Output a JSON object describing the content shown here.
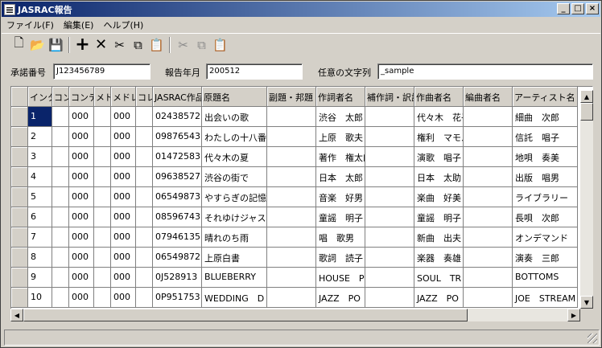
{
  "window": {
    "title": "JASRAC報告",
    "minimize": "_",
    "maximize": "□",
    "close": "×"
  },
  "menu": [
    "ファイル(F)",
    "編集(E)",
    "ヘルプ(H)"
  ],
  "toolbar": {
    "new": "🗋",
    "open": "📂",
    "save": "💾",
    "add": "+",
    "delete": "✕",
    "cut": "✂",
    "copy": "⧉",
    "paste": "📋",
    "cut2": "✂",
    "copy2": "⧉",
    "paste2": "📋"
  },
  "fields": {
    "license_label": "承諾番号",
    "license_value": "J123456789",
    "report_label": "報告年月",
    "report_value": "200512",
    "free_label": "任意の文字列",
    "free_value": "_sample"
  },
  "grid": {
    "columns": [
      "インター",
      "コンテ",
      "コンテン",
      "メド",
      "メドレー",
      "コレク",
      "JASRAC作品",
      "原題名",
      "副題・邦題",
      "作詞者名",
      "補作詞・訳詞",
      "作曲者名",
      "編曲者名",
      "アーティスト名"
    ],
    "rows": [
      [
        "1",
        "",
        "000",
        "",
        "000",
        "",
        "02438572",
        "出会いの歌",
        "",
        "渋谷　太郎",
        "",
        "代々木　花子",
        "",
        "細曲　次郎"
      ],
      [
        "2",
        "",
        "000",
        "",
        "000",
        "",
        "09876543",
        "わたしの十八番",
        "",
        "上原　歌夫",
        "",
        "権利　マモル",
        "",
        "信託　唱子"
      ],
      [
        "3",
        "",
        "000",
        "",
        "000",
        "",
        "01472583",
        "代々木の夏",
        "",
        "著作　権太郎",
        "",
        "演歌　唱子",
        "",
        "地唄　奏美"
      ],
      [
        "4",
        "",
        "000",
        "",
        "000",
        "",
        "09638527",
        "渋谷の街で",
        "",
        "日本　太郎",
        "",
        "日本　太助",
        "",
        "出版　唱男"
      ],
      [
        "5",
        "",
        "000",
        "",
        "000",
        "",
        "06549873",
        "やすらぎの記憶",
        "",
        "音楽　好男",
        "",
        "楽曲　好美",
        "",
        "ライブラリー"
      ],
      [
        "6",
        "",
        "000",
        "",
        "000",
        "",
        "08596743",
        "それゆけジャスラック",
        "",
        "童謡　明子",
        "",
        "童謡　明子",
        "",
        "長唄　次郎"
      ],
      [
        "7",
        "",
        "000",
        "",
        "000",
        "",
        "07946135",
        "晴れのち雨",
        "",
        "唱　歌男",
        "",
        "新曲　出夫",
        "",
        "オンデマンド"
      ],
      [
        "8",
        "",
        "000",
        "",
        "000",
        "",
        "06549872",
        "上原白書",
        "",
        "歌詞　読子",
        "",
        "楽器　奏雄",
        "",
        "演奏　三郎"
      ],
      [
        "9",
        "",
        "000",
        "",
        "000",
        "",
        "0J528913",
        "BLUEBERRY",
        "",
        "HOUSE　P",
        "",
        "SOUL　TR",
        "",
        "BOTTOMS"
      ],
      [
        "10",
        "",
        "000",
        "",
        "000",
        "",
        "0P951753",
        "WEDDING　D",
        "",
        "JAZZ　PO",
        "",
        "JAZZ　PO",
        "",
        "JOE　STREAM"
      ]
    ]
  }
}
